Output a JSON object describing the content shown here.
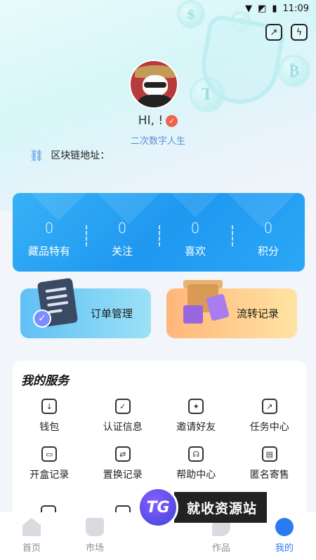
{
  "status_bar": {
    "time": "11:09",
    "wifi_icon": "wifi-icon",
    "sim_icon": "sim-icon",
    "battery_icon": "battery-icon"
  },
  "top_actions": {
    "share_icon": "share-icon",
    "flash_icon": "flash-icon"
  },
  "profile": {
    "greeting": "HI, !",
    "subtitle": "二次数字人生",
    "chain_label": "区块链地址："
  },
  "stats": [
    {
      "value": "0",
      "label": "藏品特有"
    },
    {
      "value": "0",
      "label": "关注"
    },
    {
      "value": "0",
      "label": "喜欢"
    },
    {
      "value": "0",
      "label": "积分"
    }
  ],
  "cards": {
    "order": "订单管理",
    "flow": "流转记录"
  },
  "services": {
    "title": "我的服务",
    "items": [
      {
        "label": "钱包",
        "icon": "wallet-icon",
        "glyph": "↓"
      },
      {
        "label": "认证信息",
        "icon": "certificate-icon",
        "glyph": "✓"
      },
      {
        "label": "邀请好友",
        "icon": "gift-icon",
        "glyph": "✦"
      },
      {
        "label": "任务中心",
        "icon": "task-icon",
        "glyph": "↗"
      },
      {
        "label": "开盒记录",
        "icon": "box-open-icon",
        "glyph": "▭"
      },
      {
        "label": "置换记录",
        "icon": "exchange-icon",
        "glyph": "⇄"
      },
      {
        "label": "帮助中心",
        "icon": "headset-icon",
        "glyph": "☊"
      },
      {
        "label": "匿名寄售",
        "icon": "consign-icon",
        "glyph": "▤"
      }
    ]
  },
  "tabs": [
    {
      "label": "首页",
      "icon": "home-icon"
    },
    {
      "label": "市场",
      "icon": "market-icon"
    },
    {
      "label": "",
      "icon": ""
    },
    {
      "label": "作品",
      "icon": "works-icon"
    },
    {
      "label": "我的",
      "icon": "mine-icon"
    }
  ],
  "watermark": {
    "text": "就收资源站",
    "logo_text": "TG"
  }
}
